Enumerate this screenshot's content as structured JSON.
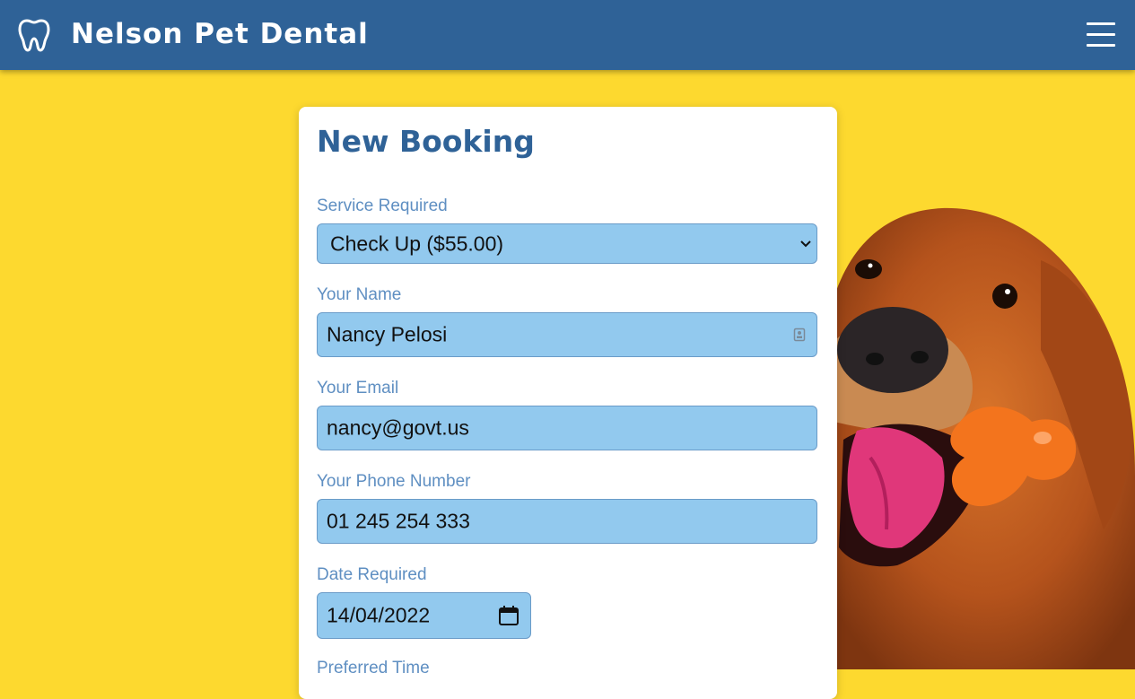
{
  "header": {
    "brand": "Nelson Pet Dental",
    "logo_icon": "tooth-icon",
    "menu_icon": "hamburger-menu-icon"
  },
  "form": {
    "title": "New Booking",
    "service": {
      "label": "Service Required",
      "value": "Check Up ($55.00)"
    },
    "name": {
      "label": "Your Name",
      "value": "Nancy Pelosi"
    },
    "email": {
      "label": "Your Email",
      "value": "nancy@govt.us"
    },
    "phone": {
      "label": "Your Phone Number",
      "value": "01 245 254 333"
    },
    "date": {
      "label": "Date Required",
      "value": "14/04/2022"
    },
    "time": {
      "label": "Preferred Time"
    }
  },
  "colors": {
    "background": "#fdd92f",
    "navbar": "#2f6297",
    "input_fill": "#92c9ee",
    "label": "#5f8fc2"
  }
}
